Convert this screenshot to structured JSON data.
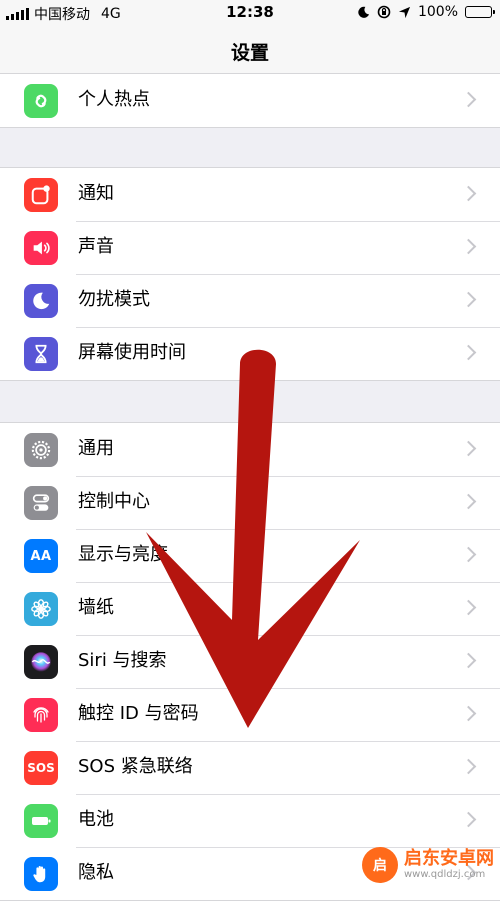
{
  "status": {
    "carrier": "中国移动",
    "network": "4G",
    "time": "12:38",
    "battery": "100%"
  },
  "nav": {
    "title": "设置"
  },
  "groups": [
    {
      "items": [
        {
          "label": "个人热点",
          "icon": "hotspot-icon",
          "color": "#4cd964"
        }
      ]
    },
    {
      "items": [
        {
          "label": "通知",
          "icon": "notifications-icon",
          "color": "#ff3b30"
        },
        {
          "label": "声音",
          "icon": "speaker-icon",
          "color": "#ff2d55"
        },
        {
          "label": "勿扰模式",
          "icon": "moon-icon",
          "color": "#5856d6"
        },
        {
          "label": "屏幕使用时间",
          "icon": "hourglass-icon",
          "color": "#5856d6"
        }
      ]
    },
    {
      "items": [
        {
          "label": "通用",
          "icon": "gear-icon",
          "color": "#8e8e93"
        },
        {
          "label": "控制中心",
          "icon": "toggles-icon",
          "color": "#8e8e93"
        },
        {
          "label": "显示与亮度",
          "icon": "text-size-icon",
          "color": "#007aff"
        },
        {
          "label": "墙纸",
          "icon": "flower-icon",
          "color": "#34aadc"
        },
        {
          "label": "Siri 与搜索",
          "icon": "siri-icon",
          "color": "#1c1c1e"
        },
        {
          "label": "触控 ID 与密码",
          "icon": "fingerprint-icon",
          "color": "#ff2d55"
        },
        {
          "label": "SOS 紧急联络",
          "icon": "sos-icon",
          "color": "#ff3b30"
        },
        {
          "label": "电池",
          "icon": "battery-icon",
          "color": "#4cd964"
        },
        {
          "label": "隐私",
          "icon": "hand-icon",
          "color": "#007aff"
        }
      ]
    }
  ],
  "icon_text": {
    "display": "AA",
    "sos": "SOS"
  },
  "watermark": {
    "main": "启东安卓网",
    "sub": "www.qdldzj.com",
    "logo_text": "启"
  }
}
